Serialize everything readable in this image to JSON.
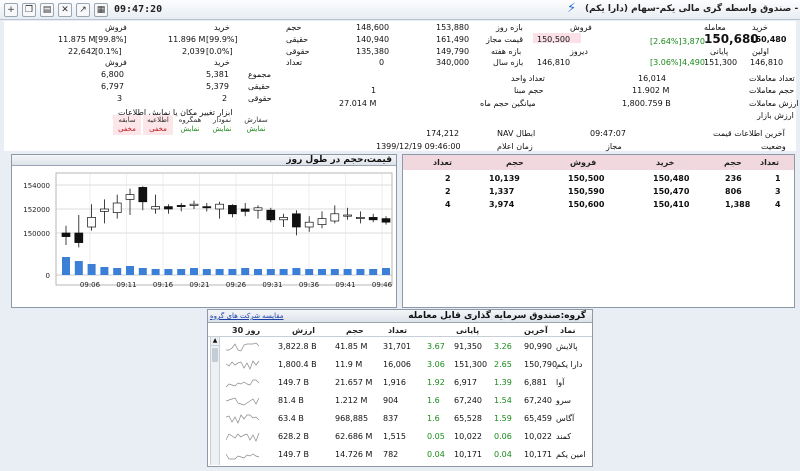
{
  "header": {
    "time": "09:47:20",
    "title": "صندوق واسطه گری مالی یکم-سهام (دارا یکم) - -"
  },
  "info": {
    "last_trade_label": "معامله",
    "last_trade_value": "150,680",
    "last_trade_change": "3,870",
    "last_trade_pct": "[2.64%]",
    "close_label": "پایانی",
    "close_value": "151,300",
    "close_change": "4,490",
    "close_pct": "[3.06%]",
    "buy_label": "خرید",
    "buy_value": "150,480",
    "first_label": "اولین",
    "first_value": "146,810",
    "sell_label": "فروش",
    "sell_value": "150,500",
    "yesterday_label": "دیروز",
    "allowed_price_label": "قیمت مجاز",
    "day_range_label": "بازه روز",
    "week_range_label": "بازه هفته",
    "year_range_label": "بازه سال",
    "day_low": "148,600",
    "day_high": "153,880",
    "allowed_low": "140,940",
    "allowed_high": "161,490",
    "week_low": "135,380",
    "week_high": "149,790",
    "year_low": "0",
    "year_high": "340,000",
    "trades_count_label": "تعداد معاملات",
    "trades_count": "16,014",
    "volume_label": "حجم معاملات",
    "volume": "11.902 M",
    "value_label": "ارزش معاملات",
    "value": "1,800.759 B",
    "market_value_label": "ارزش بازار",
    "unit_label": "تعداد واحد",
    "base_volume_label": "حجم مبنا",
    "base_volume": "1",
    "avg_month_label": "میانگین حجم ماه",
    "avg_month": "27.014 M",
    "last_info_label": "آخرین اطلاعات قیمت",
    "last_info": "09:47:07",
    "status_label": "وضعیت",
    "status": "مجاز",
    "nav_label": "NAV ابطال",
    "nav_value": "174,212",
    "nav_time_label": "زمان اعلام",
    "nav_time": "1399/12/19 09:46:00"
  },
  "legal": {
    "col_volume": "حجم",
    "col_buy": "خرید",
    "col_sell": "فروش",
    "row_real": "حقیقی",
    "row_legal": "حقوقی",
    "real_vol": "140,940",
    "real_buy": "11.896 M",
    "real_buy_pct": "[99.9%]",
    "real_sell": "11.875 M",
    "real_sell_pct": "[99.8%]",
    "legal_vol": "135,380",
    "legal_buy": "2,039",
    "legal_buy_pct": "[0.0%]",
    "legal_sell": "22,642",
    "legal_sell_pct": "[0.1%]",
    "count_label": "تعداد",
    "count_buy_label": "خرید",
    "count_sell_label": "فروش",
    "sum_label": "مجموع",
    "real_label2": "حقیقی",
    "legal_label2": "حقوقی",
    "sum_buy": "5,381",
    "sum_sell": "6,800",
    "real_buy2": "5,379",
    "real_sell2": "6,797",
    "legal_buy2": "2",
    "legal_sell2": "3"
  },
  "tools": {
    "title": "ابزار تغییر مکان یا نمایش اطلاعات",
    "items": [
      {
        "label": "سفارش",
        "state": "نمایش"
      },
      {
        "label": "نمودار",
        "state": "نمایش"
      },
      {
        "label": "همگروه",
        "state": "نمایش"
      },
      {
        "label": "اطلاعیه",
        "state": "مخفی"
      },
      {
        "label": "سابقه",
        "state": "مخفی"
      }
    ]
  },
  "chart_panel": {
    "title": "قیمت،حجم در طول روز"
  },
  "chart_data": {
    "type": "candlestick",
    "y_ticks": [
      "154000",
      "152000",
      "150000",
      "0"
    ],
    "x_ticks": [
      "09:06",
      "09:11",
      "09:16",
      "09:21",
      "09:26",
      "09:31",
      "09:36",
      "09:41",
      "09:46"
    ],
    "ylim": [
      148500,
      155000
    ],
    "grid": true,
    "candles": [
      {
        "o": 150000,
        "c": 149700,
        "h": 150600,
        "l": 149000
      },
      {
        "o": 150000,
        "c": 149200,
        "h": 151500,
        "l": 148800
      },
      {
        "o": 150500,
        "c": 151300,
        "h": 152400,
        "l": 150200
      },
      {
        "o": 151800,
        "c": 152000,
        "h": 152800,
        "l": 150800
      },
      {
        "o": 151700,
        "c": 152500,
        "h": 153200,
        "l": 151200
      },
      {
        "o": 152800,
        "c": 153200,
        "h": 153700,
        "l": 151500
      },
      {
        "o": 153800,
        "c": 152600,
        "h": 153900,
        "l": 151900
      },
      {
        "o": 152000,
        "c": 152200,
        "h": 153200,
        "l": 151600
      },
      {
        "o": 152200,
        "c": 152000,
        "h": 152400,
        "l": 151600
      },
      {
        "o": 152300,
        "c": 152200,
        "h": 152500,
        "l": 151800
      },
      {
        "o": 152300,
        "c": 152400,
        "h": 152700,
        "l": 152000
      },
      {
        "o": 152200,
        "c": 152100,
        "h": 152500,
        "l": 151800
      },
      {
        "o": 152000,
        "c": 152400,
        "h": 152600,
        "l": 151200
      },
      {
        "o": 152300,
        "c": 151600,
        "h": 152400,
        "l": 151300
      },
      {
        "o": 152000,
        "c": 151800,
        "h": 152500,
        "l": 151400
      },
      {
        "o": 151900,
        "c": 152100,
        "h": 152300,
        "l": 151200
      },
      {
        "o": 151900,
        "c": 151100,
        "h": 152100,
        "l": 150900
      },
      {
        "o": 151100,
        "c": 151300,
        "h": 151600,
        "l": 150500
      },
      {
        "o": 151600,
        "c": 150500,
        "h": 151900,
        "l": 149800
      },
      {
        "o": 150500,
        "c": 150900,
        "h": 151400,
        "l": 150100
      },
      {
        "o": 150700,
        "c": 151200,
        "h": 151800,
        "l": 150400
      },
      {
        "o": 151000,
        "c": 151600,
        "h": 152300,
        "l": 150800
      },
      {
        "o": 151400,
        "c": 151500,
        "h": 152100,
        "l": 151100
      },
      {
        "o": 151300,
        "c": 151300,
        "h": 151800,
        "l": 150800
      },
      {
        "o": 151300,
        "c": 151100,
        "h": 151600,
        "l": 150900
      },
      {
        "o": 151200,
        "c": 150900,
        "h": 151400,
        "l": 150700
      }
    ],
    "volume": [
      0.9,
      0.7,
      0.55,
      0.4,
      0.35,
      0.45,
      0.35,
      0.3,
      0.3,
      0.3,
      0.35,
      0.3,
      0.3,
      0.3,
      0.35,
      0.3,
      0.3,
      0.3,
      0.35,
      0.3,
      0.3,
      0.3,
      0.3,
      0.3,
      0.3,
      0.35
    ]
  },
  "queue": {
    "headers": [
      "تعداد",
      "حجم",
      "خرید",
      "فروش",
      "حجم",
      "تعداد"
    ],
    "rows": [
      {
        "buy_count": "1",
        "buy_vol": "236",
        "buy_price": "150,480",
        "sell_price": "150,500",
        "sell_vol": "10,139",
        "sell_count": "2"
      },
      {
        "buy_count": "3",
        "buy_vol": "806",
        "buy_price": "150,470",
        "sell_price": "150,590",
        "sell_vol": "1,337",
        "sell_count": "2"
      },
      {
        "buy_count": "4",
        "buy_vol": "1,388",
        "buy_price": "150,410",
        "sell_price": "150,600",
        "sell_vol": "3,974",
        "sell_count": "4"
      }
    ]
  },
  "group": {
    "title": "گروه:صندوق سرمایه گذاری قابل معامله",
    "compare_link": "مقایسه شرکت های گروه",
    "headers": [
      "نماد",
      "آخرین",
      "",
      "پایانی",
      "",
      "تعداد",
      "حجم",
      "ارزش",
      "30 روز"
    ],
    "rows": [
      {
        "name": "پالایش",
        "last": "90,990",
        "last_pct": "3.26",
        "close": "91,350",
        "close_pct": "3.67",
        "count": "31,701",
        "vol": "41.85 M",
        "value": "3,822.8 B"
      },
      {
        "name": "دارا یکم",
        "last": "150,790",
        "last_pct": "2.65",
        "close": "151,300",
        "close_pct": "3.06",
        "count": "16,006",
        "vol": "11.9 M",
        "value": "1,800.4 B"
      },
      {
        "name": "آوا",
        "last": "6,881",
        "last_pct": "1.39",
        "close": "6,917",
        "close_pct": "1.92",
        "count": "1,916",
        "vol": "21.657 M",
        "value": "149.7 B"
      },
      {
        "name": "سرو",
        "last": "67,240",
        "last_pct": "1.54",
        "close": "67,240",
        "close_pct": "1.6",
        "count": "904",
        "vol": "1.212 M",
        "value": "81.4 B"
      },
      {
        "name": "آگاس",
        "last": "65,459",
        "last_pct": "1.59",
        "close": "65,528",
        "close_pct": "1.6",
        "count": "837",
        "vol": "968,885",
        "value": "63.4 B"
      },
      {
        "name": "کمند",
        "last": "10,022",
        "last_pct": "0.06",
        "close": "10,022",
        "close_pct": "0.05",
        "count": "1,515",
        "vol": "62.686 M",
        "value": "628.2 B"
      },
      {
        "name": "امین یکم",
        "last": "10,171",
        "last_pct": "0.04",
        "close": "10,171",
        "close_pct": "0.04",
        "count": "782",
        "vol": "14.726 M",
        "value": "149.7 B"
      }
    ]
  },
  "colors": {
    "up": "#1a8a1a",
    "down": "#c01818",
    "volume_bar": "#3c7fd6",
    "candle_up": "#ffffff",
    "candle_down": "#111111"
  }
}
